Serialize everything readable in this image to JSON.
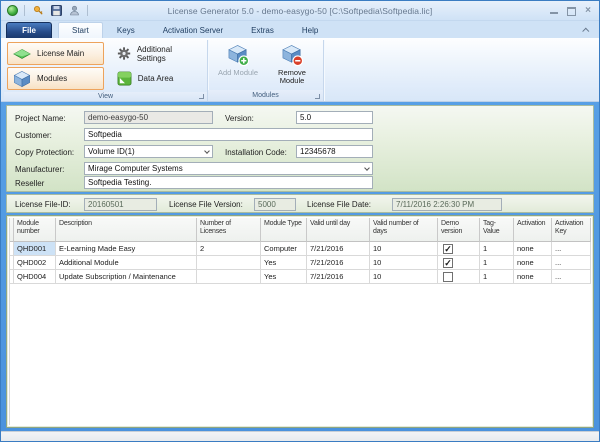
{
  "window": {
    "title": "License Generator 5.0 - demo-easygo-50 [C:\\Softpedia\\Softpedia.lic]",
    "close_glyph": "×"
  },
  "icons": {
    "checkbox_check": "✓",
    "gear": "additional-settings-gear",
    "cube": "blue-3d-cube",
    "diamond": "green-diamond-arrow"
  },
  "tabs": [
    {
      "label": "File"
    },
    {
      "label": "Start",
      "active": true
    },
    {
      "label": "Keys"
    },
    {
      "label": "Activation Server"
    },
    {
      "label": "Extras"
    },
    {
      "label": "Help"
    }
  ],
  "ribbon": {
    "groups": [
      {
        "label": "View"
      },
      {
        "label": "Modules"
      }
    ],
    "buttons": {
      "license_main": "License Main",
      "modules": "Modules",
      "additional_settings": "Additional Settings",
      "data_area": "Data Area",
      "add_module": "Add Module",
      "remove_module": "Remove Module"
    }
  },
  "form": {
    "project_name": {
      "label": "Project Name:",
      "value": "demo-easygo-50"
    },
    "version": {
      "label": "Version:",
      "value": "5.0"
    },
    "customer": {
      "label": "Customer:",
      "value": "Softpedia"
    },
    "copy_protection": {
      "label": "Copy Protection:",
      "value": "Volume ID(1)"
    },
    "installation_code": {
      "label": "Installation Code:",
      "value": "12345678"
    },
    "manufacturer": {
      "label": "Manufacturer:",
      "value": "Mirage Computer Systems"
    },
    "reseller": {
      "label": "Reseller",
      "value": "Softpedia Testing."
    }
  },
  "license_info": {
    "file_id": {
      "label": "License File-ID:",
      "value": "20160501"
    },
    "file_version": {
      "label": "License File Version:",
      "value": "5000"
    },
    "file_date": {
      "label": "License File Date:",
      "value": "7/11/2016 2:26:30 PM"
    }
  },
  "table": {
    "columns": [
      "Module number",
      "Description",
      "Number of Licenses",
      "Module Type",
      "Valid until day",
      "Valid number of days",
      "Demo version",
      "Tag-Value",
      "Activation",
      "Activation Key"
    ],
    "rows": [
      {
        "module_number": "QHD001",
        "description": "E-Learning Made Easy",
        "num_licenses": "2",
        "module_type": "Computer",
        "valid_until": "7/21/2016",
        "valid_days": "10",
        "demo": true,
        "tag_value": "1",
        "activation": "none",
        "activation_key": "...",
        "selected": true
      },
      {
        "module_number": "QHD002",
        "description": "Additional Module",
        "num_licenses": "",
        "module_type": "Yes",
        "valid_until": "7/21/2016",
        "valid_days": "10",
        "demo": true,
        "tag_value": "1",
        "activation": "none",
        "activation_key": "..."
      },
      {
        "module_number": "QHD004",
        "description": "Update Subscription / Maintenance",
        "num_licenses": "",
        "module_type": "Yes",
        "valid_until": "7/21/2016",
        "valid_days": "10",
        "demo": false,
        "tag_value": "1",
        "activation": "none",
        "activation_key": "..."
      }
    ]
  }
}
